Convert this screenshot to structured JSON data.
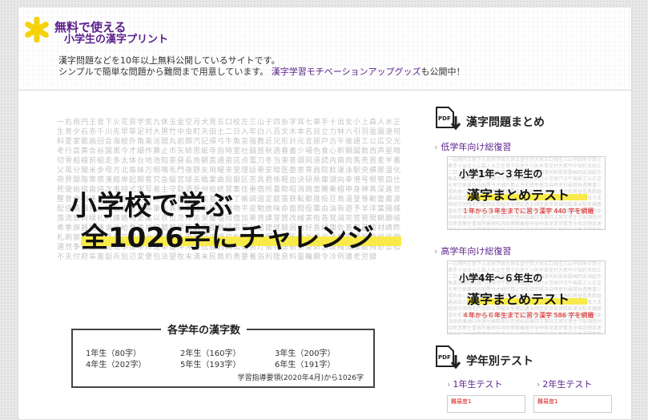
{
  "header": {
    "title_line1": "無料で使える",
    "title_line2": "小学生の漢字プリント",
    "desc_line1": "漢字問題などを10年以上無料公開しているサイトです。",
    "desc_line2_a": "シンプルで簡単な問題から難問まで用意しています。",
    "desc_link": "漢字学習モチベーションアップグッズ",
    "desc_line2_b": "も公開中！"
  },
  "hero": {
    "line1": "小学校で学ぶ",
    "line2": "全1026字にチャレンジ",
    "bg_text": "一右雨円王音下火花貝学気九休玉金空月犬見五口校左三山子四糸字耳七車手十出女小上森人水正生青夕石赤千川先早草足村大男竹中虫町天田土二日入年白八百文木本名目立力林六引羽雲園遠何科夏家歌画回会海絵外角楽活間丸岩顔汽記帰弓牛魚京強教近兄形計元言原戸古午後語工公広交光考行高黄合谷国黒今才細作算止市矢姉思紙寺自時室社弱首秋週春書少場色食心新親図数西声星晴切雪船線前組走多太体台地池知茶昼長鳥朝直通弟店点電刀冬当東答頭同道読内南肉馬売買麦半番父風分聞米歩母方北毎妹万明鳴毛門夜野友用曜来里理話悪安暗医委意育員院飲運泳駅央横屋温化荷界開階寒感漢館岸起期客究急級宮球去橋業曲局銀区苦具君係軽血決研県庫湖向幸港号根祭皿仕死使始指歯詩次事持式実写者主守取酒受州拾終習集住重宿所暑助昭消商章勝乗植申身神真深進世整昔全相送想息速族他打対待代第題炭短談着注柱丁帳調追定庭笛鉄転都度投豆島湯登等動童農波配倍箱畑発反坂板皮悲美鼻筆氷表秒病品負部服福物平返勉放味命面問役薬由油有遊予羊洋葉陽様落流旅両緑礼列練路和愛案以衣位茨印英栄媛塩岡億加果貨課芽賀改械害街各覚潟完官管関観願岐希季旗器機議求泣給挙漁共協鏡競極熊訓軍郡群径景芸欠結建健験固功好香候康佐差菜最埼材崎昨札刷察参産散残氏司試児治滋辞鹿失借種周祝順初松笑唱焼照城縄臣信井成省清静席積折節説浅戦選然争倉巣束側続卒孫帯隊達単置仲沖兆低底的典伝徒努灯働特徳栃奈梨熱念敗梅博阪飯飛必票標不夫付府阜富副兵別辺変便包法望牧末満未民無約勇要養浴利陸良料量輪類令冷例連老労録"
  },
  "counts": {
    "title": "各学年の漢字数",
    "g1": "1年生（80字）",
    "g2": "2年生（160字）",
    "g3": "3年生（200字）",
    "g4": "4年生（202字）",
    "g5": "5年生（193字）",
    "g6": "6年生（191字）",
    "note": "学習指導要領(2020年4月)から1026字"
  },
  "side": {
    "summary_title": "漢字問題まとめ",
    "low_link": "低学年向け総復習",
    "low_card_l1": "小学1年〜３年生の",
    "low_card_l2": "漢字まとめテスト",
    "low_card_l3": "１年から３年生までに習う漢字 440 字を網羅",
    "high_link": "高学年向け総復習",
    "high_card_l1": "小学4年〜６年生の",
    "high_card_l2": "漢字まとめテスト",
    "high_card_l3": "４年から６年生までに習う漢字 586 字を網羅",
    "grade_title": "学年別テスト",
    "grade1_link": "1年生テスト",
    "grade2_link": "2年生テスト",
    "mini_label": "難易度1",
    "pdf_label": "PDF"
  },
  "colors": {
    "accent": "#5a1e8c",
    "highlight": "#f7ea4a",
    "logo": "#f5d20a"
  }
}
